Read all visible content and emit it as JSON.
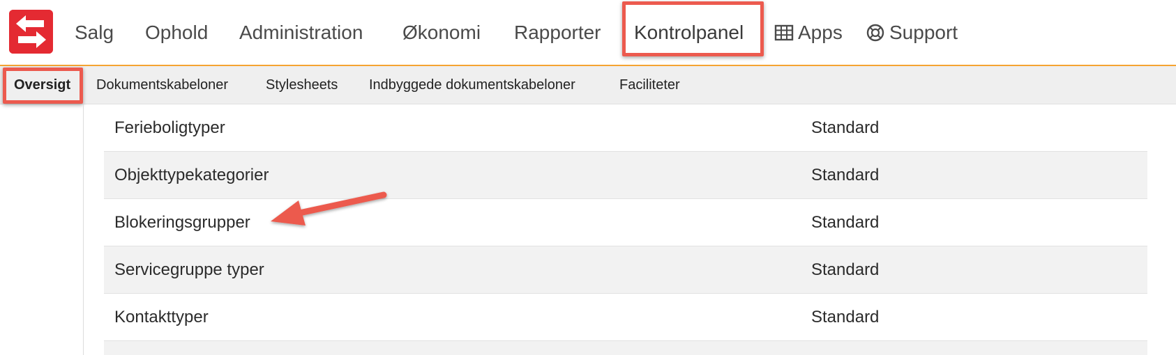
{
  "nav": {
    "items": [
      "Salg",
      "Ophold",
      "Administration",
      "Økonomi",
      "Rapporter",
      "Kontrolpanel"
    ],
    "apps_label": "Apps",
    "apps_icon": "grid-icon",
    "support_label": "Support",
    "support_icon": "lifebuoy-icon",
    "active": "Kontrolpanel"
  },
  "subnav": {
    "items": [
      "Oversigt",
      "Dokumentskabeloner",
      "Stylesheets",
      "Indbyggede dokumentskabeloner",
      "Faciliteter"
    ],
    "active": "Oversigt"
  },
  "table": {
    "rows": [
      {
        "name": "Ferieboligtyper",
        "value": "Standard"
      },
      {
        "name": "Objekttypekategorier",
        "value": "Standard"
      },
      {
        "name": "Blokeringsgrupper",
        "value": "Standard"
      },
      {
        "name": "Servicegruppe typer",
        "value": "Standard"
      },
      {
        "name": "Kontakttyper",
        "value": "Standard"
      }
    ]
  },
  "colors": {
    "brand_red": "#e42a32",
    "accent_orange": "#f5a331",
    "annotation_red": "#ec5a4e"
  }
}
